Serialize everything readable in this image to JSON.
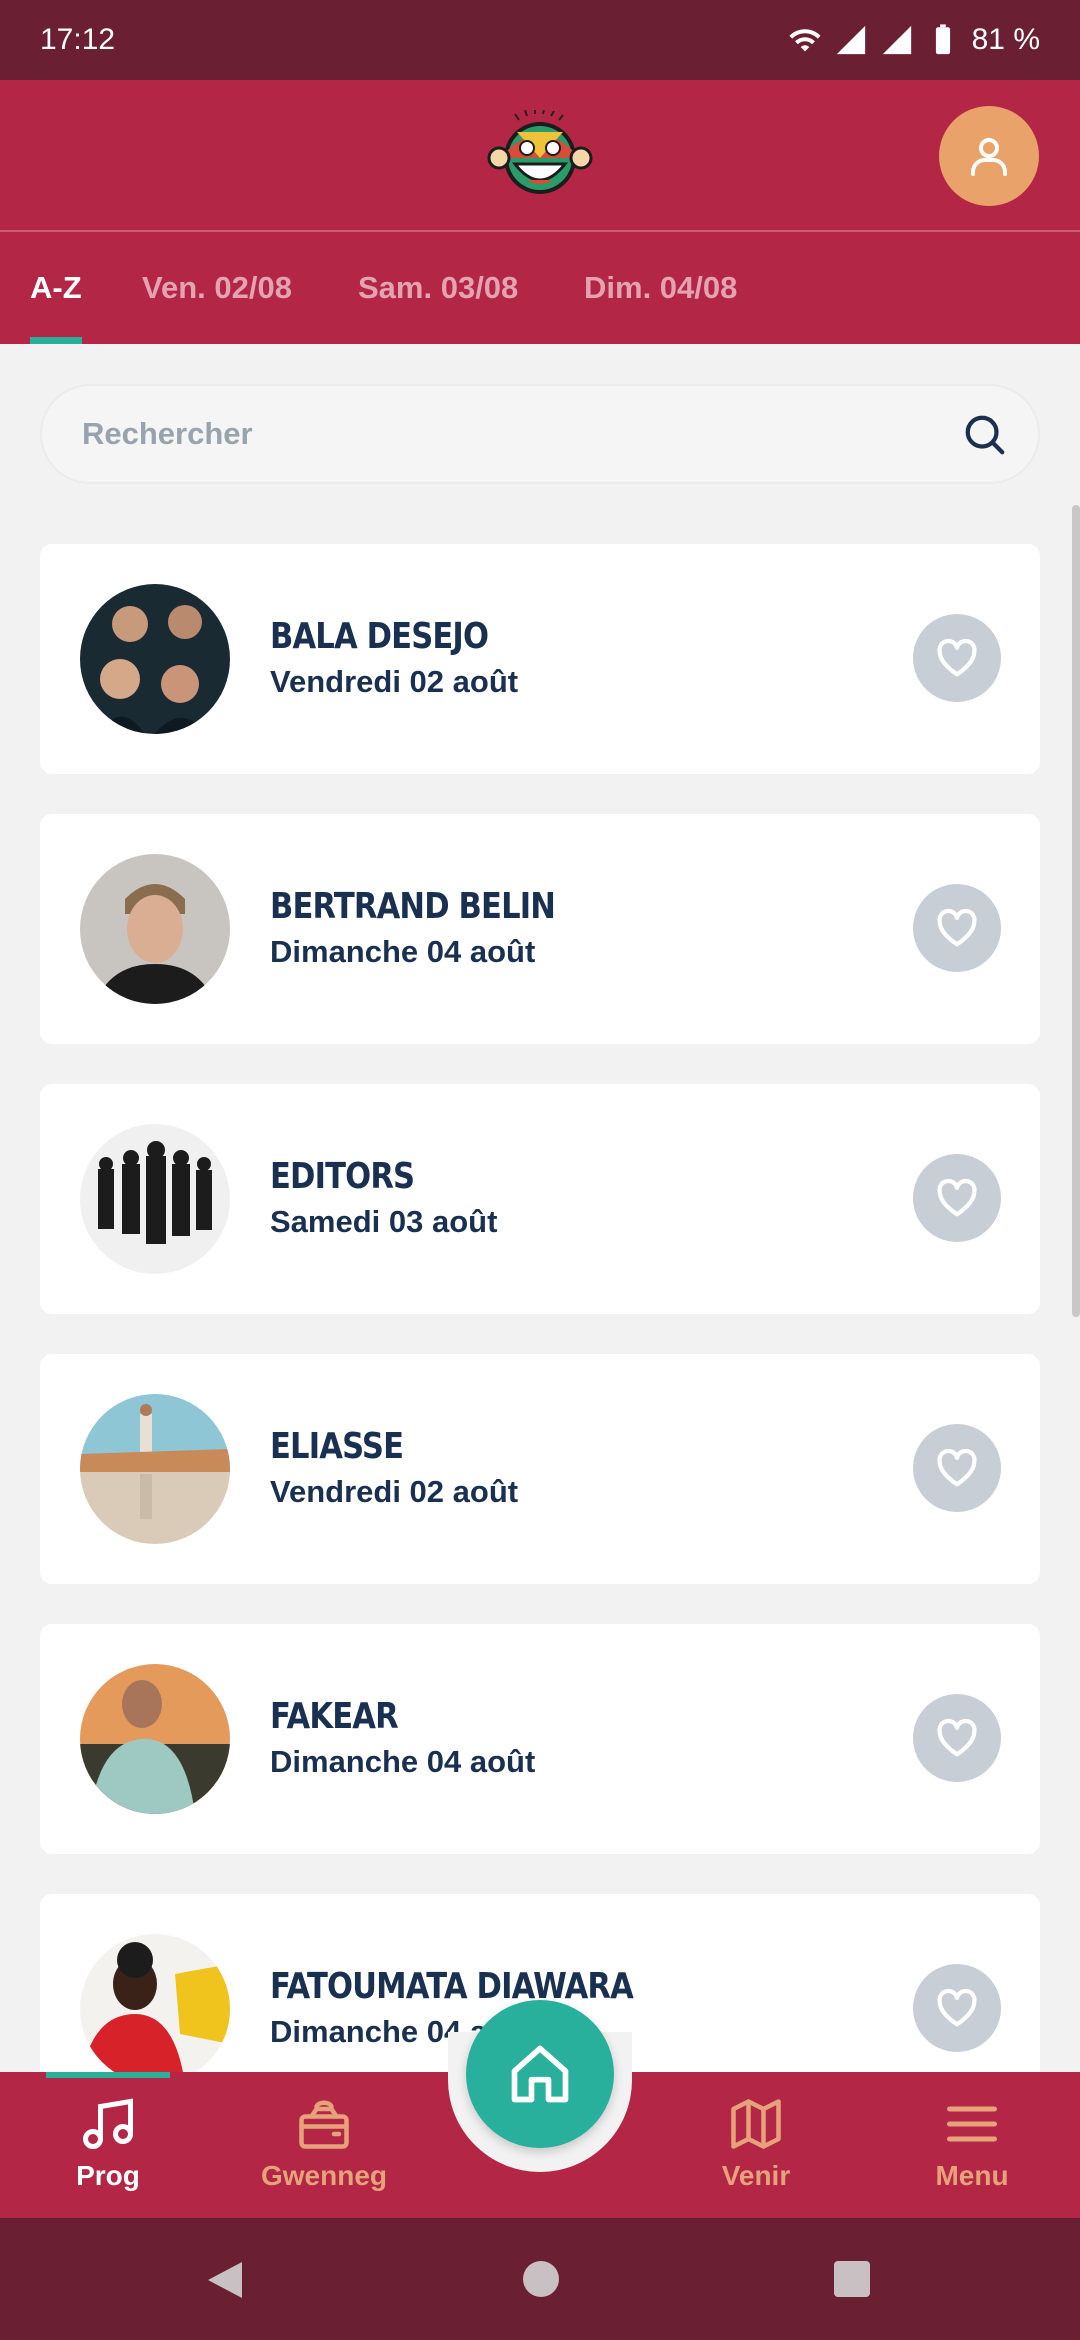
{
  "status_bar": {
    "time": "17:12",
    "battery": "81 %"
  },
  "tabs": [
    {
      "label": "A-Z",
      "active": true
    },
    {
      "label": "Ven. 02/08",
      "active": false
    },
    {
      "label": "Sam. 03/08",
      "active": false
    },
    {
      "label": "Dim. 04/08",
      "active": false
    }
  ],
  "search": {
    "placeholder": "Rechercher"
  },
  "artists": [
    {
      "name": "BALA DESEJO",
      "date": "Vendredi 02 août"
    },
    {
      "name": "BERTRAND BELIN",
      "date": "Dimanche 04 août"
    },
    {
      "name": "EDITORS",
      "date": "Samedi 03 août"
    },
    {
      "name": "ELIASSE",
      "date": "Vendredi 02 août"
    },
    {
      "name": "FAKEAR",
      "date": "Dimanche 04 août"
    },
    {
      "name": "FATOUMATA DIAWARA",
      "date": "Dimanche 04 août"
    }
  ],
  "bottom_nav": [
    {
      "label": "Prog",
      "icon": "music-note-icon",
      "active": true
    },
    {
      "label": "Gwenneg",
      "icon": "wallet-icon",
      "active": false
    },
    {
      "label": "Venir",
      "icon": "map-icon",
      "active": false
    },
    {
      "label": "Menu",
      "icon": "menu-icon",
      "active": false
    }
  ],
  "colors": {
    "brand": "#b42646",
    "dark_brand": "#6b1f33",
    "accent": "#28b09c",
    "profile": "#e8a26a",
    "text": "#1a3050"
  }
}
